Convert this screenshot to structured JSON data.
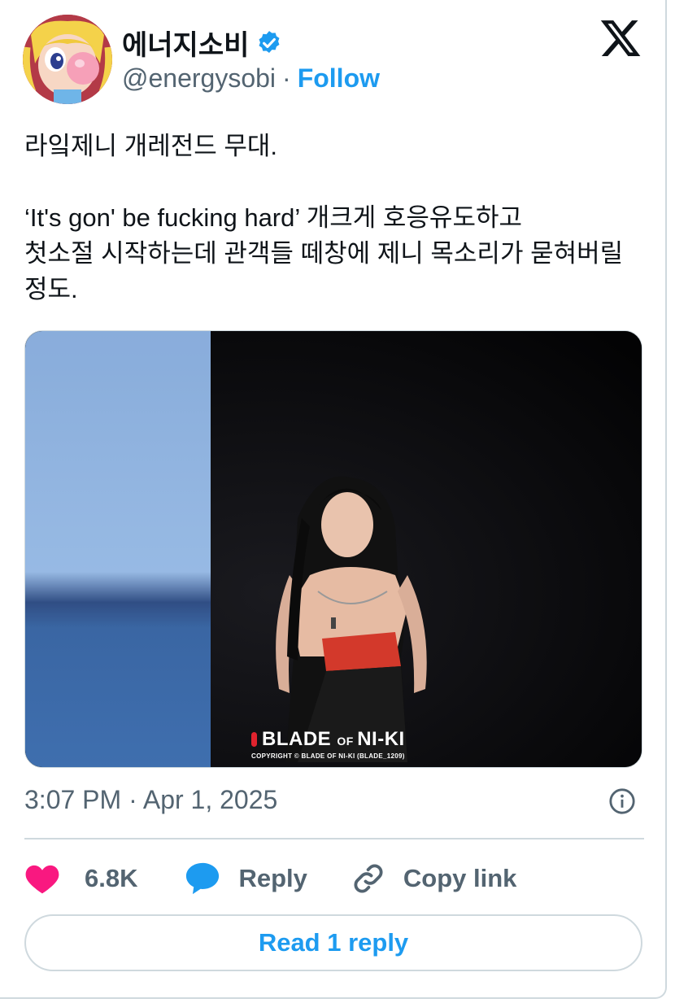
{
  "author": {
    "display_name": "에너지소비",
    "handle": "@energysobi",
    "separator": "·",
    "follow_label": "Follow"
  },
  "tweet": {
    "text": "라잌제니 개레전드 무대.\n\n‘It's gon' be fucking hard’ 개크게 호응유도하고\n첫소절 시작하는데 관객들 떼창에 제니 목소리가 묻혀버릴\n정도.",
    "timestamp": "3:07 PM · Apr 1, 2025"
  },
  "media": {
    "watermark_left": "BLADE ",
    "watermark_of": "OF ",
    "watermark_right": "NI-KI",
    "watermark_copyright": "COPYRIGHT © BLADE OF NI-KI  (BLADE_1209)"
  },
  "actions": {
    "like_count": "6.8K",
    "reply_label": "Reply",
    "copy_label": "Copy link",
    "read_replies_label": "Read 1 reply"
  },
  "colors": {
    "accent": "#1d9bf0",
    "like": "#f91880",
    "secondary_text": "#536471",
    "border": "#cfd9de"
  },
  "icons": [
    "verified-badge-icon",
    "x-logo-icon",
    "info-icon",
    "heart-icon",
    "reply-bubble-icon",
    "link-icon"
  ]
}
